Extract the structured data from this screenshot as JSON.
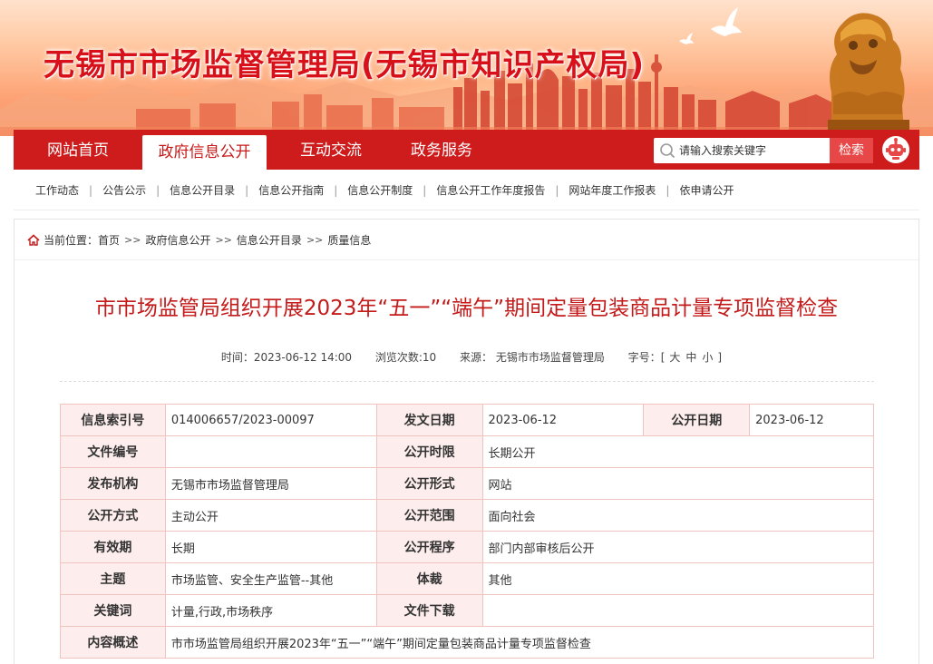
{
  "header": {
    "site_title": "无锡市市场监督管理局(无锡市知识产权局)"
  },
  "nav": {
    "items": [
      {
        "label": "网站首页"
      },
      {
        "label": "政府信息公开"
      },
      {
        "label": "互动交流"
      },
      {
        "label": "政务服务"
      }
    ],
    "active_index": 1,
    "search_placeholder": "请输入搜索关键字",
    "search_button": "检索"
  },
  "subnav": {
    "items": [
      "工作动态",
      "公告公示",
      "信息公开目录",
      "信息公开指南",
      "信息公开制度",
      "信息公开工作年度报告",
      "网站年度工作报表",
      "依申请公开"
    ],
    "separator": "|"
  },
  "breadcrumb": {
    "prefix": "当前位置：",
    "items": [
      "首页",
      "政府信息公开",
      "信息公开目录",
      "质量信息"
    ],
    "arrow": ">>"
  },
  "article": {
    "title": "市市场监管局组织开展2023年“五一”“端午”期间定量包装商品计量专项监督检查",
    "meta": {
      "time": "时间：2023-06-12 14:00",
      "views": "浏览次数:10",
      "source": "来源： 无锡市市场监督管理局",
      "font_size_label": "字号：",
      "font_open": "[",
      "font_large": "大",
      "font_medium": "中",
      "font_small": "小",
      "font_close": "]"
    }
  },
  "info_table": {
    "index_no_label": "信息索引号",
    "index_no": "014006657/2023-00097",
    "issue_date_label": "发文日期",
    "issue_date": "2023-06-12",
    "publish_date_label": "公开日期",
    "publish_date": "2023-06-12",
    "doc_no_label": "文件编号",
    "doc_no": "",
    "time_limit_label": "公开时限",
    "time_limit": "长期公开",
    "publisher_label": "发布机构",
    "publisher": "无锡市市场监督管理局",
    "form_label": "公开形式",
    "form": "网站",
    "method_label": "公开方式",
    "method": "主动公开",
    "scope_label": "公开范围",
    "scope": "面向社会",
    "validity_label": "有效期",
    "validity": "长期",
    "procedure_label": "公开程序",
    "procedure": "部门内部审核后公开",
    "topic_label": "主题",
    "topic": "市场监管、安全生产监管--其他",
    "genre_label": "体裁",
    "genre": "其他",
    "keywords_label": "关键词",
    "keywords": "计量,行政,市场秩序",
    "download_label": "文件下载",
    "download": "",
    "summary_label": "内容概述",
    "summary": "市市场监管局组织开展2023年“五一”“端午”期间定量包装商品计量专项监督检查"
  },
  "colors": {
    "brand_red": "#ce1b1b",
    "title_red": "#c41a1a",
    "table_header_bg": "#fdeeed",
    "table_border": "#efc4bf"
  }
}
